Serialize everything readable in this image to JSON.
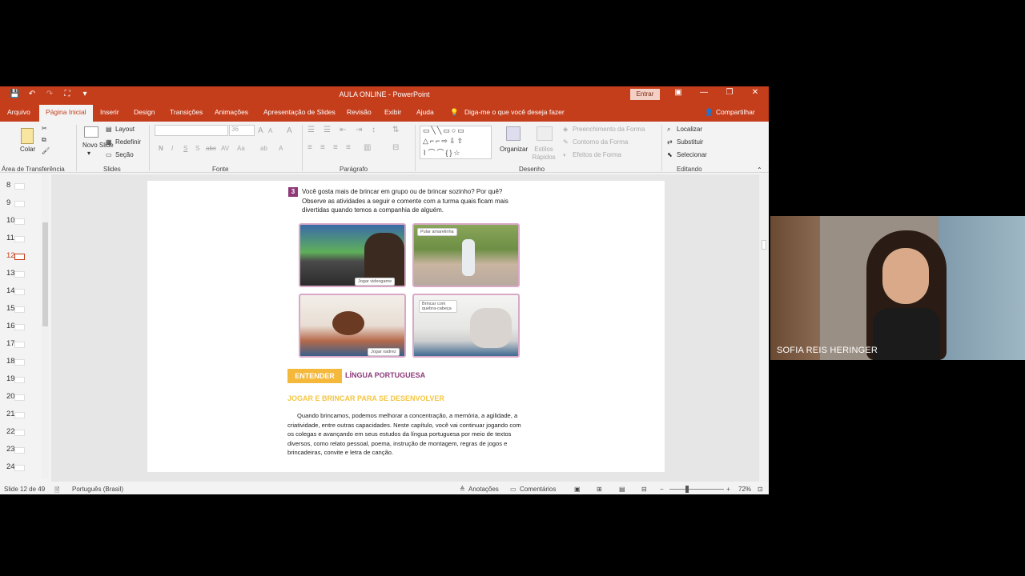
{
  "window": {
    "title": "AULA ONLINE  -  PowerPoint",
    "signin_label": "Entrar",
    "minimize": "—",
    "restore": "❐",
    "close": "✕",
    "ribbon_display": "▣"
  },
  "tabs": [
    "Arquivo",
    "Página Inicial",
    "Inserir",
    "Design",
    "Transições",
    "Animações",
    "Apresentação de Slides",
    "Revisão",
    "Exibir",
    "Ajuda"
  ],
  "tell_me": "Diga-me o que você deseja fazer",
  "share": "Compartilhar",
  "ribbon": {
    "clipboard": {
      "paste": "Colar",
      "group": "Área de Transferência"
    },
    "slides": {
      "new_slide": "Novo Slide",
      "new_slide_arrow": "▾",
      "layout": "Layout",
      "reset": "Redefinir",
      "section": "Seção",
      "group": "Slides"
    },
    "font": {
      "size": "36",
      "bold": "N",
      "italic": "I",
      "underline": "S",
      "shadow": "S",
      "strike": "abc",
      "spacing": "AV",
      "case": "Aa",
      "grow": "A",
      "shrink": "A",
      "clear": "A",
      "color": "A",
      "highlight": "ab",
      "group": "Fonte"
    },
    "paragraph": {
      "group": "Parágrafo"
    },
    "drawing": {
      "arrange": "Organizar",
      "quick_styles": "Estilos Rápidos",
      "fill": "Preenchimento da Forma",
      "outline": "Contorno da Forma",
      "effects": "Efeitos de Forma",
      "group": "Desenho"
    },
    "editing": {
      "find": "Localizar",
      "replace": "Substituir",
      "select": "Selecionar",
      "group": "Editando"
    }
  },
  "thumbnails": [
    "8",
    "9",
    "10",
    "11",
    "12",
    "13",
    "14",
    "15",
    "16",
    "17",
    "18",
    "19",
    "20",
    "21",
    "22",
    "23",
    "24"
  ],
  "selected_slide": "12",
  "slide": {
    "question_number": "3",
    "question": "Você gosta mais de brincar em grupo ou de brincar sozinho? Por quê? Observe as atividades a seguir e comente com a turma quais ficam mais divertidas quando temos a companhia de alguém.",
    "captions": [
      "Jogar videogame",
      "Pular amarelinha",
      "Jogar xadrez",
      "Brincar com quebra-cabeça"
    ],
    "banner": "ENTENDER",
    "subject": "LÍNGUA PORTUGUESA",
    "heading": "JOGAR E BRINCAR PARA SE DESENVOLVER",
    "body": "Quando brincamos, podemos melhorar a concentração, a memória, a agilidade, a criatividade, entre outras capacidades. Neste capítulo, você vai continuar jogando com os colegas e avançando em seus estudos da língua portuguesa por meio de textos diversos, como relato pessoal, poema, instrução de montagem, regras de jogos e brincadeiras, convite e letra de canção."
  },
  "status": {
    "slide_counter": "Slide 12 de 49",
    "language": "Português (Brasil)",
    "notes": "Anotações",
    "comments": "Comentários",
    "zoom": "72%",
    "zoom_out": "−",
    "zoom_in": "+"
  },
  "participant": {
    "name": "SOFIA REIS HERINGER"
  }
}
